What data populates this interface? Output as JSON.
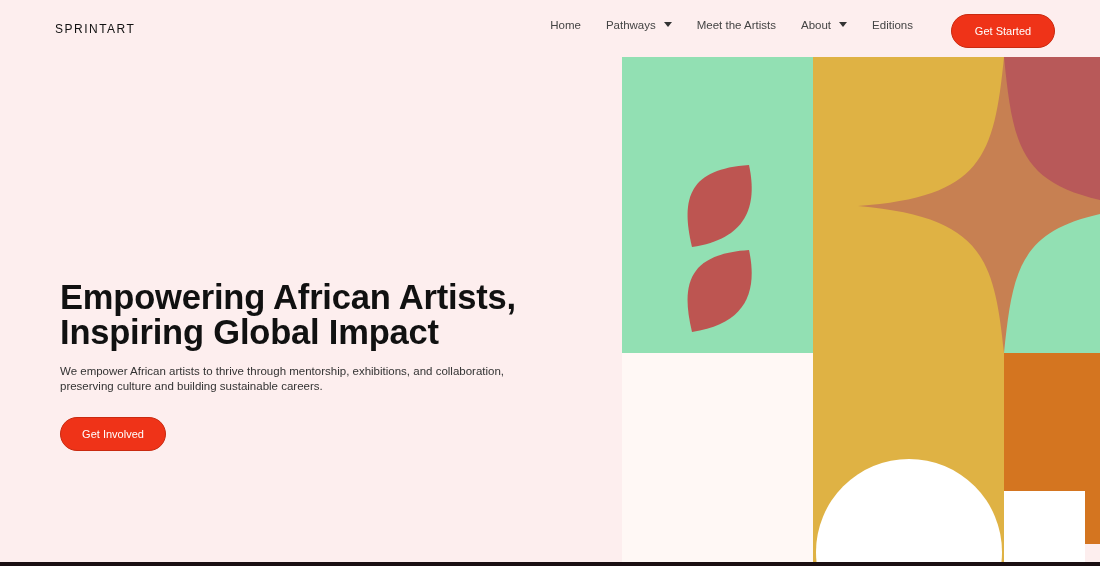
{
  "brand": "SPRINTART",
  "nav": [
    {
      "label": "Home",
      "has_menu": false
    },
    {
      "label": "Pathways",
      "has_menu": true
    },
    {
      "label": "Meet the Artists",
      "has_menu": false
    },
    {
      "label": "About",
      "has_menu": true
    },
    {
      "label": "Editions",
      "has_menu": false
    }
  ],
  "cta": "Get Started",
  "hero": {
    "title": "Empowering African Artists, Inspiring Global Impact",
    "text": "We empower African artists to thrive through mentorship, exhibitions, and collaboration, preserving culture and building sustainable careers.",
    "button": "Get Involved"
  }
}
